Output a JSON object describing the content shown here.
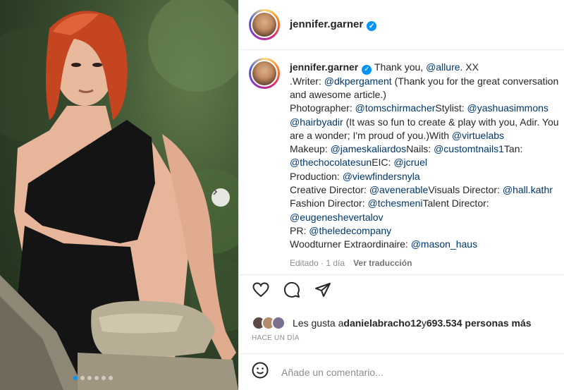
{
  "post": {
    "username": "jennifer.garner",
    "caption_lines": [
      [
        {
          "t": "u",
          "v": "jennifer.garner"
        },
        {
          "t": "v",
          "v": ""
        },
        {
          "t": "x",
          "v": " Thank you, "
        },
        {
          "t": "m",
          "v": "@allure"
        },
        {
          "t": "x",
          "v": ". XX"
        }
      ],
      [
        {
          "t": "x",
          "v": ".Writer: "
        },
        {
          "t": "m",
          "v": "@dkpergament"
        },
        {
          "t": "x",
          "v": " (Thank you for the great conversation"
        }
      ],
      [
        {
          "t": "x",
          "v": "and awesome article.)"
        }
      ],
      [
        {
          "t": "x",
          "v": "Photographer: "
        },
        {
          "t": "m",
          "v": "@tomschirmacher"
        },
        {
          "t": "x",
          "v": "Stylist: "
        },
        {
          "t": "m",
          "v": "@yashuasimmons"
        }
      ],
      [
        {
          "t": "m",
          "v": "@hairbyadir"
        },
        {
          "t": "x",
          "v": " (It was so fun to create & play with you, Adir. You"
        }
      ],
      [
        {
          "t": "x",
          "v": "are a wonder; I'm proud of you.)With "
        },
        {
          "t": "m",
          "v": "@virtuelabs"
        }
      ],
      [
        {
          "t": "x",
          "v": "Makeup: "
        },
        {
          "t": "m",
          "v": "@jameskaliardos"
        },
        {
          "t": "x",
          "v": "Nails: "
        },
        {
          "t": "m",
          "v": "@customtnails1"
        },
        {
          "t": "x",
          "v": "Tan:"
        }
      ],
      [
        {
          "t": "m",
          "v": "@thechocolatesun"
        },
        {
          "t": "x",
          "v": "EIC: "
        },
        {
          "t": "m",
          "v": "@jcruel"
        }
      ],
      [
        {
          "t": "x",
          "v": "Production: "
        },
        {
          "t": "m",
          "v": "@viewfindersnyla"
        }
      ],
      [
        {
          "t": "x",
          "v": "Creative Director: "
        },
        {
          "t": "m",
          "v": "@avenerable"
        },
        {
          "t": "x",
          "v": "Visuals Director: "
        },
        {
          "t": "m",
          "v": "@hall.kathr"
        }
      ],
      [
        {
          "t": "x",
          "v": "Fashion Director: "
        },
        {
          "t": "m",
          "v": "@tchesmeni"
        },
        {
          "t": "x",
          "v": "Talent Director:"
        }
      ],
      [
        {
          "t": "m",
          "v": "@eugeneshevertalov"
        }
      ],
      [
        {
          "t": "x",
          "v": "PR: "
        },
        {
          "t": "m",
          "v": "@theledecompany"
        }
      ],
      [
        {
          "t": "x",
          "v": "Woodturner Extraordinaire: "
        },
        {
          "t": "m",
          "v": "@mason_haus"
        }
      ]
    ],
    "edited_label": "Editado · 1 día",
    "translation_link": "Ver traducción",
    "likes_prefix": "Les gusta a ",
    "likes_user": "danielabracho12",
    "likes_middle": " y ",
    "likes_count": "693.534 personas más",
    "time_ago": "HACE UN DÍA",
    "comment_placeholder": "Añade un comentario..."
  },
  "carousel": {
    "dot_count": 6,
    "active_index": 0
  },
  "colors": {
    "mention": "#00376b",
    "verified": "#0095f6",
    "muted": "#8e8e8e"
  },
  "icons": [
    "verified-badge-icon",
    "heart-icon",
    "comment-icon",
    "share-icon",
    "emoji-icon",
    "chevron-right-icon"
  ]
}
